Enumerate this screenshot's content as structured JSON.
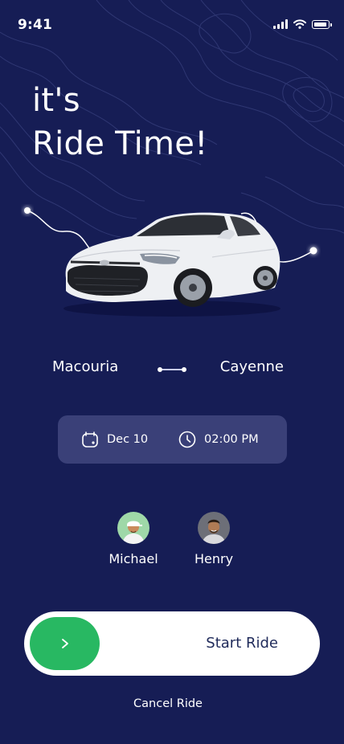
{
  "status_bar": {
    "time": "9:41"
  },
  "headline": {
    "line1": "it's",
    "line2": "Ride Time!"
  },
  "route": {
    "from": "Macouria",
    "to": "Cayenne"
  },
  "schedule": {
    "date": "Dec 10",
    "time": "02:00 PM"
  },
  "passengers": [
    {
      "name": "Michael"
    },
    {
      "name": "Henry"
    }
  ],
  "slider": {
    "label": "Start Ride"
  },
  "cancel": {
    "label": "Cancel Ride"
  },
  "colors": {
    "background": "#161d55",
    "card": "#3a4078",
    "accent_green": "#28b862",
    "slider_text": "#1f2a5a"
  },
  "icons": [
    "signal-icon",
    "wifi-icon",
    "battery-icon",
    "calendar-icon",
    "clock-icon",
    "chevron-right-icon"
  ]
}
